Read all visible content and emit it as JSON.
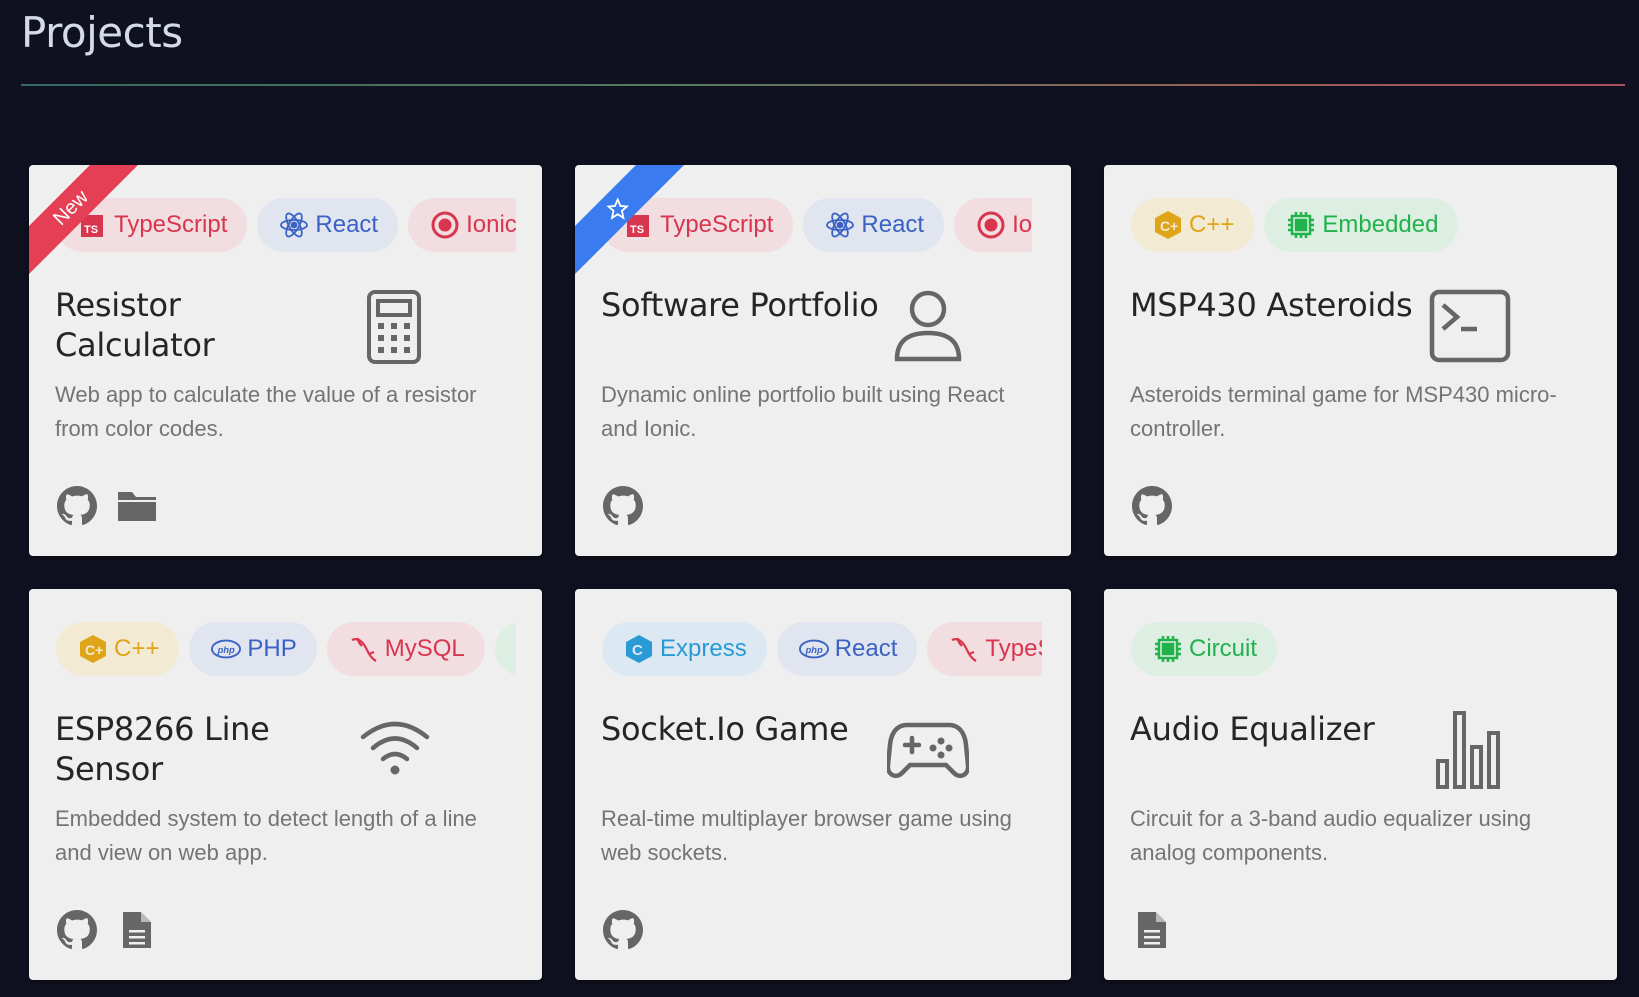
{
  "page": {
    "title": "Projects"
  },
  "cards": [
    {
      "ribbon": "New",
      "tags": [
        "TypeScript",
        "React",
        "Ionic"
      ],
      "title_line1": "Resistor",
      "title_line2": "Calculator",
      "icon": "calculator-icon",
      "description": "Web app to calculate the value of a resistor from color codes.",
      "links": [
        "github-icon",
        "folder-icon"
      ]
    },
    {
      "ribbon_icon": "star-icon",
      "tags": [
        "TypeScript",
        "React",
        "Ionic"
      ],
      "title": "Software Portfolio",
      "icon": "user-icon",
      "description": "Dynamic online portfolio built using React and Ionic.",
      "links": [
        "github-icon"
      ]
    },
    {
      "tags": [
        "C++",
        "Embedded"
      ],
      "title": "MSP430 Asteroids",
      "icon": "terminal-icon",
      "description": "Asteroids terminal game for MSP430 micro-controller.",
      "links": [
        "github-icon"
      ]
    },
    {
      "tags": [
        "C++",
        "PHP",
        "MySQL"
      ],
      "title_line1": "ESP8266 Line",
      "title_line2": "Sensor",
      "icon": "wifi-icon",
      "description": "Embedded system to detect length of a line and view on web app.",
      "links": [
        "github-icon",
        "document-icon"
      ]
    },
    {
      "tags": [
        "Express",
        "React",
        "TypeSc"
      ],
      "title": "Socket.Io Game",
      "icon": "gamepad-icon",
      "description": "Real-time multiplayer browser game using web sockets.",
      "links": [
        "github-icon"
      ]
    },
    {
      "tags": [
        "Circuit"
      ],
      "title": "Audio Equalizer",
      "icon": "bar-chart-icon",
      "description": "Circuit for a 3-band audio equalizer using analog components.",
      "links": [
        "document-icon"
      ]
    }
  ],
  "colors": {
    "background": "#0f1120",
    "card": "#efefef",
    "ribbon_new": "#e43f55",
    "ribbon_featured": "#3a7bef"
  }
}
